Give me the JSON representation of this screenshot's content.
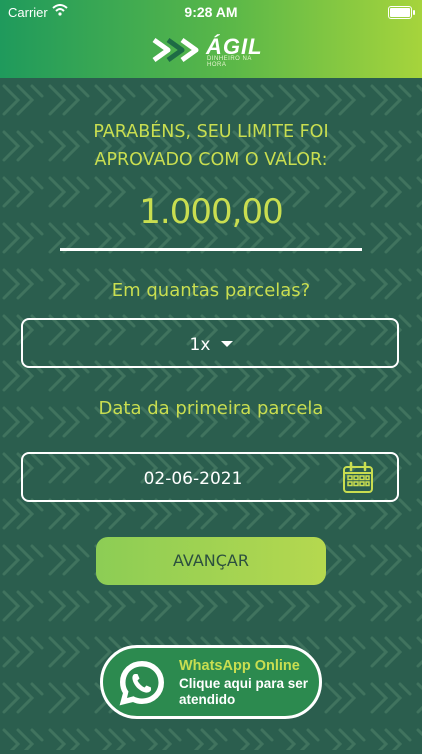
{
  "status_bar": {
    "carrier": "Carrier",
    "time": "9:28 AM"
  },
  "header": {
    "logo_text": "ÁGIL",
    "logo_tagline": "DINHEIRO NA HORA"
  },
  "approval": {
    "headline_line1": "PARABÉNS, SEU LIMITE FOI",
    "headline_line2": "APROVADO COM O VALOR:",
    "amount": "1.000,00"
  },
  "installments": {
    "label": "Em quantas parcelas?",
    "selected": "1x"
  },
  "first_payment": {
    "label": "Data da primeira parcela",
    "date": "02-06-2021"
  },
  "actions": {
    "advance_label": "AVANÇAR"
  },
  "whatsapp": {
    "title": "WhatsApp Online",
    "subtitle": "Clique aqui para ser atendido"
  },
  "colors": {
    "accent": "#c9de50",
    "background": "#2b5e4e",
    "whatsapp_green": "#2c8a4f"
  }
}
